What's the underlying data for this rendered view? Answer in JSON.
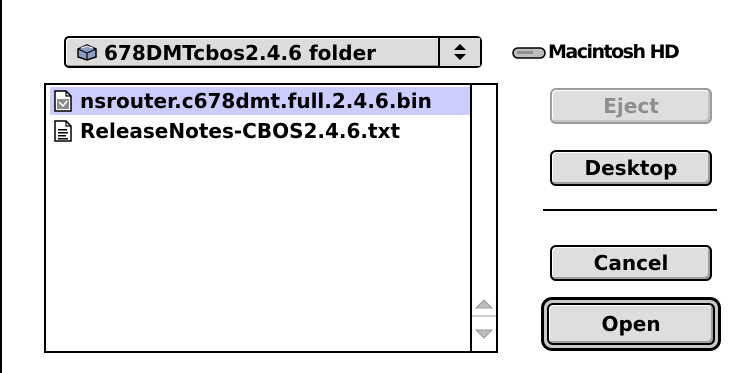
{
  "folder_popup": {
    "label": "678DMTcbos2.4.6 folder",
    "icon": "folder-icon",
    "arrows_icon": "up-down-arrows-icon"
  },
  "volume": {
    "label": "Macintosh HD",
    "icon": "hard-disk-icon"
  },
  "files": [
    {
      "name": "nsrouter.c678dmt.full.2.4.6.bin",
      "icon": "binary-file-icon",
      "selected": true
    },
    {
      "name": "ReleaseNotes-CBOS2.4.6.txt",
      "icon": "text-file-icon",
      "selected": false
    }
  ],
  "buttons": {
    "eject": "Eject",
    "desktop": "Desktop",
    "cancel": "Cancel",
    "open": "Open"
  },
  "colors": {
    "selection": "#ccccff",
    "button_face": "#dedede",
    "disabled_text": "#8e8e8e"
  }
}
